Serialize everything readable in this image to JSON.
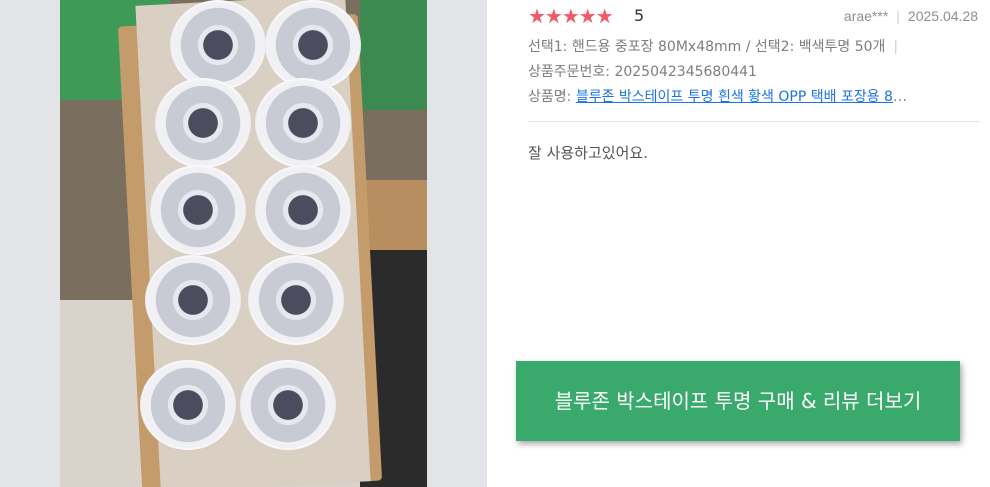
{
  "review": {
    "stars": "★★★★★",
    "rating": "5",
    "author": "arae***",
    "date": "2025.04.28",
    "option_text": "선택1: 핸드용 중포장 80Mx48mm / 선택2: 백색투명 50개",
    "option_separator": "|",
    "order_number": "상품주문번호: 2025042345680441",
    "product_label": "상품명: ",
    "product_link": "블루존 박스테이프 투명 흰색 황색 OPP 택배 포장용 8",
    "content": "잘 사용하고있어요."
  },
  "cta": {
    "label": "블루존 박스테이프 투명 구매 & 리뷰 더보기"
  },
  "colors": {
    "star": "#f05a6a",
    "link": "#1a73e8",
    "cta_bg": "#3aaa6c",
    "page_bg": "#e3e4e8"
  }
}
